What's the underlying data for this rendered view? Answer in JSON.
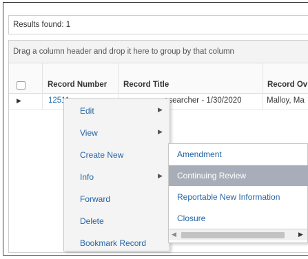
{
  "results": {
    "text": "Results found: 1"
  },
  "grid": {
    "group_hint": "Drag a column header and drop it here to group by that column",
    "headers": [
      "Record Number",
      "Record Title",
      "Record Ov"
    ],
    "row": {
      "record_number": "12511",
      "record_title": "esearcher - 1/30/2020",
      "record_owner": "Malloy, Ma"
    }
  },
  "context_menu": {
    "items": [
      {
        "label": "Edit",
        "has_submenu": true
      },
      {
        "label": "View",
        "has_submenu": true
      },
      {
        "label": "Create New",
        "has_submenu": false
      },
      {
        "label": "Info",
        "has_submenu": true
      },
      {
        "label": "Forward",
        "has_submenu": false
      },
      {
        "label": "Delete",
        "has_submenu": false
      },
      {
        "label": "Bookmark Record",
        "has_submenu": false
      }
    ]
  },
  "submenu": {
    "items": [
      {
        "label": "Amendment",
        "highlighted": false
      },
      {
        "label": "Continuing Review",
        "highlighted": true
      },
      {
        "label": "Reportable New Information",
        "highlighted": false
      },
      {
        "label": "Closure",
        "highlighted": false
      }
    ]
  },
  "colors": {
    "link": "#2465a6",
    "highlight": "#a8aeb9"
  },
  "icons": {
    "row_expand": "caret-right-icon",
    "submenu_arrow": "caret-right-icon"
  }
}
